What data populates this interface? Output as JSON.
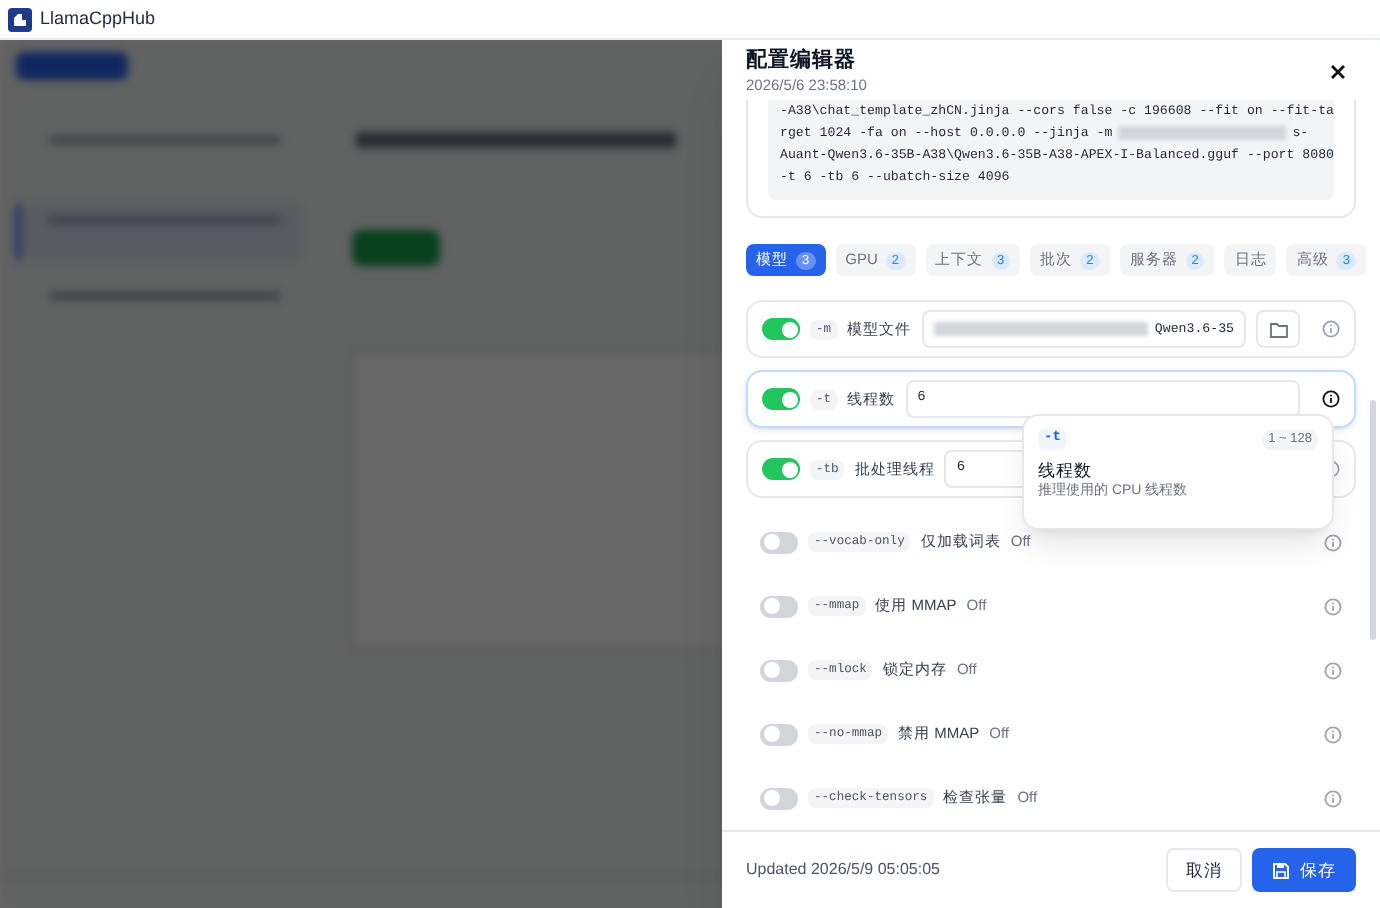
{
  "window": {
    "title": "LlamaCppHub"
  },
  "drawer": {
    "title": "配置编辑器",
    "subtitle": "2026/5/6 23:58:10",
    "command_lines": [
      {
        "text": "-A38\\chat_template_zhCN.jinja --cors false -c 196608 --fit on --fit-ta"
      },
      {
        "text": "rget 1024 -fa on --host 0.0.0.0 --jinja -m",
        "redacted": true,
        "after": "s-"
      },
      {
        "text": "Auant-Qwen3.6-35B-A38\\Qwen3.6-35B-A38-APEX-I-Balanced.gguf --port 8080"
      },
      {
        "text": "-t 6 -tb 6 --ubatch-size 4096"
      }
    ],
    "tabs": [
      {
        "label": "模型",
        "count": "3",
        "selected": true
      },
      {
        "label": "GPU",
        "count": "2",
        "selected": false
      },
      {
        "label": "上下文",
        "count": "3",
        "selected": false
      },
      {
        "label": "批次",
        "count": "2",
        "selected": false
      },
      {
        "label": "服务器",
        "count": "2",
        "selected": false
      },
      {
        "label": "日志",
        "selected": false
      },
      {
        "label": "高级",
        "count": "3",
        "selected": false
      }
    ],
    "params": [
      {
        "kind": "file",
        "on": true,
        "flag": "-m",
        "label": "模型文件",
        "value": "Qwen3.6-35",
        "redacted": true,
        "selected": false
      },
      {
        "kind": "text",
        "on": true,
        "flag": "-t",
        "label": "线程数",
        "value": "6",
        "selected": true
      },
      {
        "kind": "text",
        "on": true,
        "flag": "-tb",
        "label": "批处理线程",
        "value": "6",
        "selected": false
      },
      {
        "kind": "switch",
        "on": false,
        "flag": "--vocab-only",
        "label": "仅加载词表",
        "value": "Off",
        "selected": false
      },
      {
        "kind": "switch",
        "on": false,
        "flag": "--mmap",
        "label": "使用 MMAP",
        "value": "Off",
        "selected": false
      },
      {
        "kind": "switch",
        "on": false,
        "flag": "--mlock",
        "label": "锁定内存",
        "value": "Off",
        "selected": false
      },
      {
        "kind": "switch",
        "on": false,
        "flag": "--no-mmap",
        "label": "禁用 MMAP",
        "value": "Off",
        "selected": false
      },
      {
        "kind": "switch",
        "on": false,
        "flag": "--check-tensors",
        "label": "检查张量",
        "value": "Off",
        "selected": false
      }
    ],
    "tooltip": {
      "flag": "-t",
      "range": "1 ~ 128",
      "title": "线程数",
      "description": "推理使用的 CPU 线程数"
    },
    "footer": {
      "updated": "Updated 2026/5/9 05:05:05",
      "cancel": "取消",
      "save": "保存"
    }
  }
}
